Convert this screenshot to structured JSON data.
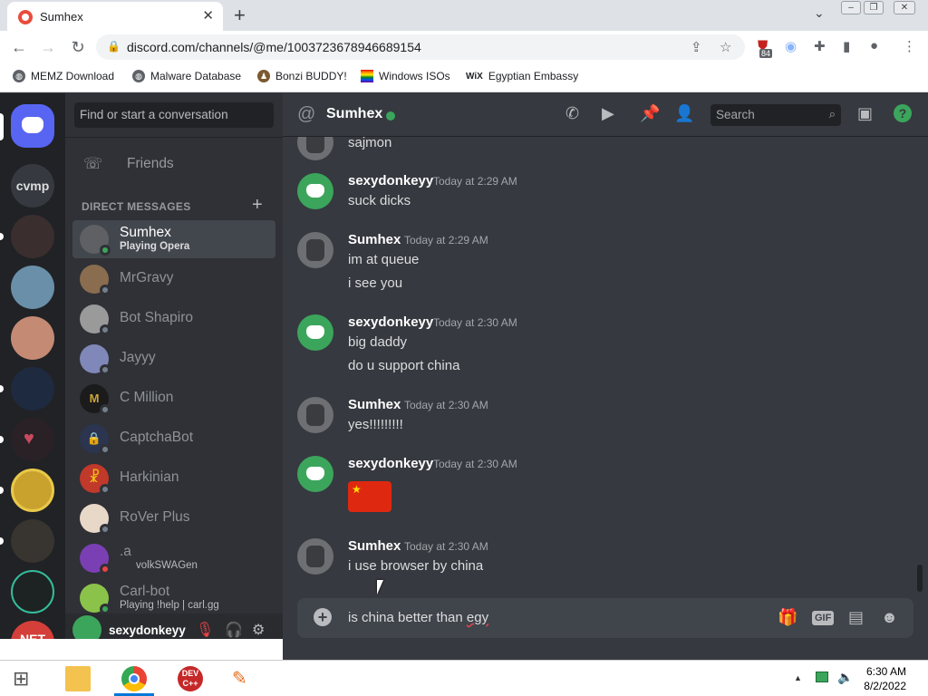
{
  "browser": {
    "tab_title": "Sumhex",
    "url": "discord.com/channels/@me/1003723678946689154",
    "extension_badge": "84",
    "bookmarks": [
      "MEMZ Download",
      "Malware Database",
      "Bonzi BUDDY!",
      "Windows ISOs",
      "Egyptian Embassy"
    ]
  },
  "servers": {
    "cvmp_label": "cvmp",
    "net_label": "NET"
  },
  "dm_sidebar": {
    "search_placeholder": "Find or start a conversation",
    "friends_label": "Friends",
    "section_header": "DIRECT MESSAGES",
    "items": [
      {
        "name": "Sumhex",
        "sub": "Playing Opera",
        "status": "online",
        "color": "#3ba55c"
      },
      {
        "name": "MrGravy",
        "sub": "",
        "status": "offline",
        "color": "#747f8d"
      },
      {
        "name": "Bot Shapiro",
        "sub": "",
        "status": "offline",
        "color": "#747f8d"
      },
      {
        "name": "Jayyy",
        "sub": "",
        "status": "offline",
        "color": "#747f8d"
      },
      {
        "name": "C Million",
        "sub": "",
        "status": "offline",
        "color": "#747f8d"
      },
      {
        "name": "CaptchaBot",
        "sub": "",
        "status": "offline",
        "color": "#747f8d"
      },
      {
        "name": "Harkinian",
        "sub": "",
        "status": "offline",
        "color": "#747f8d"
      },
      {
        "name": "RoVer Plus",
        "sub": "",
        "status": "offline",
        "color": "#747f8d"
      },
      {
        "name": ".a",
        "sub": "volkSWAGen",
        "status": "dnd",
        "color": "#ed4245"
      },
      {
        "name": "Carl-bot",
        "sub": "Playing !help | carl.gg",
        "status": "online",
        "color": "#3ba55c"
      }
    ],
    "user_panel_name": "sexydonkeyy"
  },
  "chat": {
    "header_name": "Sumhex",
    "search_placeholder": "Search",
    "messages": [
      {
        "author": "",
        "time": "",
        "lines": [
          "sajmon"
        ]
      },
      {
        "author": "sexydonkeyy",
        "time": "Today at 2:29 AM",
        "lines": [
          "suck dicks"
        ]
      },
      {
        "author": "Sumhex",
        "time": "Today at 2:29 AM",
        "lines": [
          "im at queue",
          "i see you"
        ]
      },
      {
        "author": "sexydonkeyy",
        "time": "Today at 2:30 AM",
        "lines": [
          "big daddy",
          "do u support china"
        ]
      },
      {
        "author": "Sumhex",
        "time": "Today at 2:30 AM",
        "lines": [
          "yes!!!!!!!!!"
        ]
      },
      {
        "author": "sexydonkeyy",
        "time": "Today at 2:30 AM",
        "lines": [],
        "emoji": "china-flag"
      },
      {
        "author": "Sumhex",
        "time": "Today at 2:30 AM",
        "lines": [
          "i use browser by china"
        ]
      }
    ],
    "composer_text_plain": "is china better than ",
    "composer_text_misspelled": "egy"
  },
  "taskbar": {
    "devcpp_label": "DEV C++",
    "time": "6:30 AM",
    "date": "8/2/2022"
  }
}
